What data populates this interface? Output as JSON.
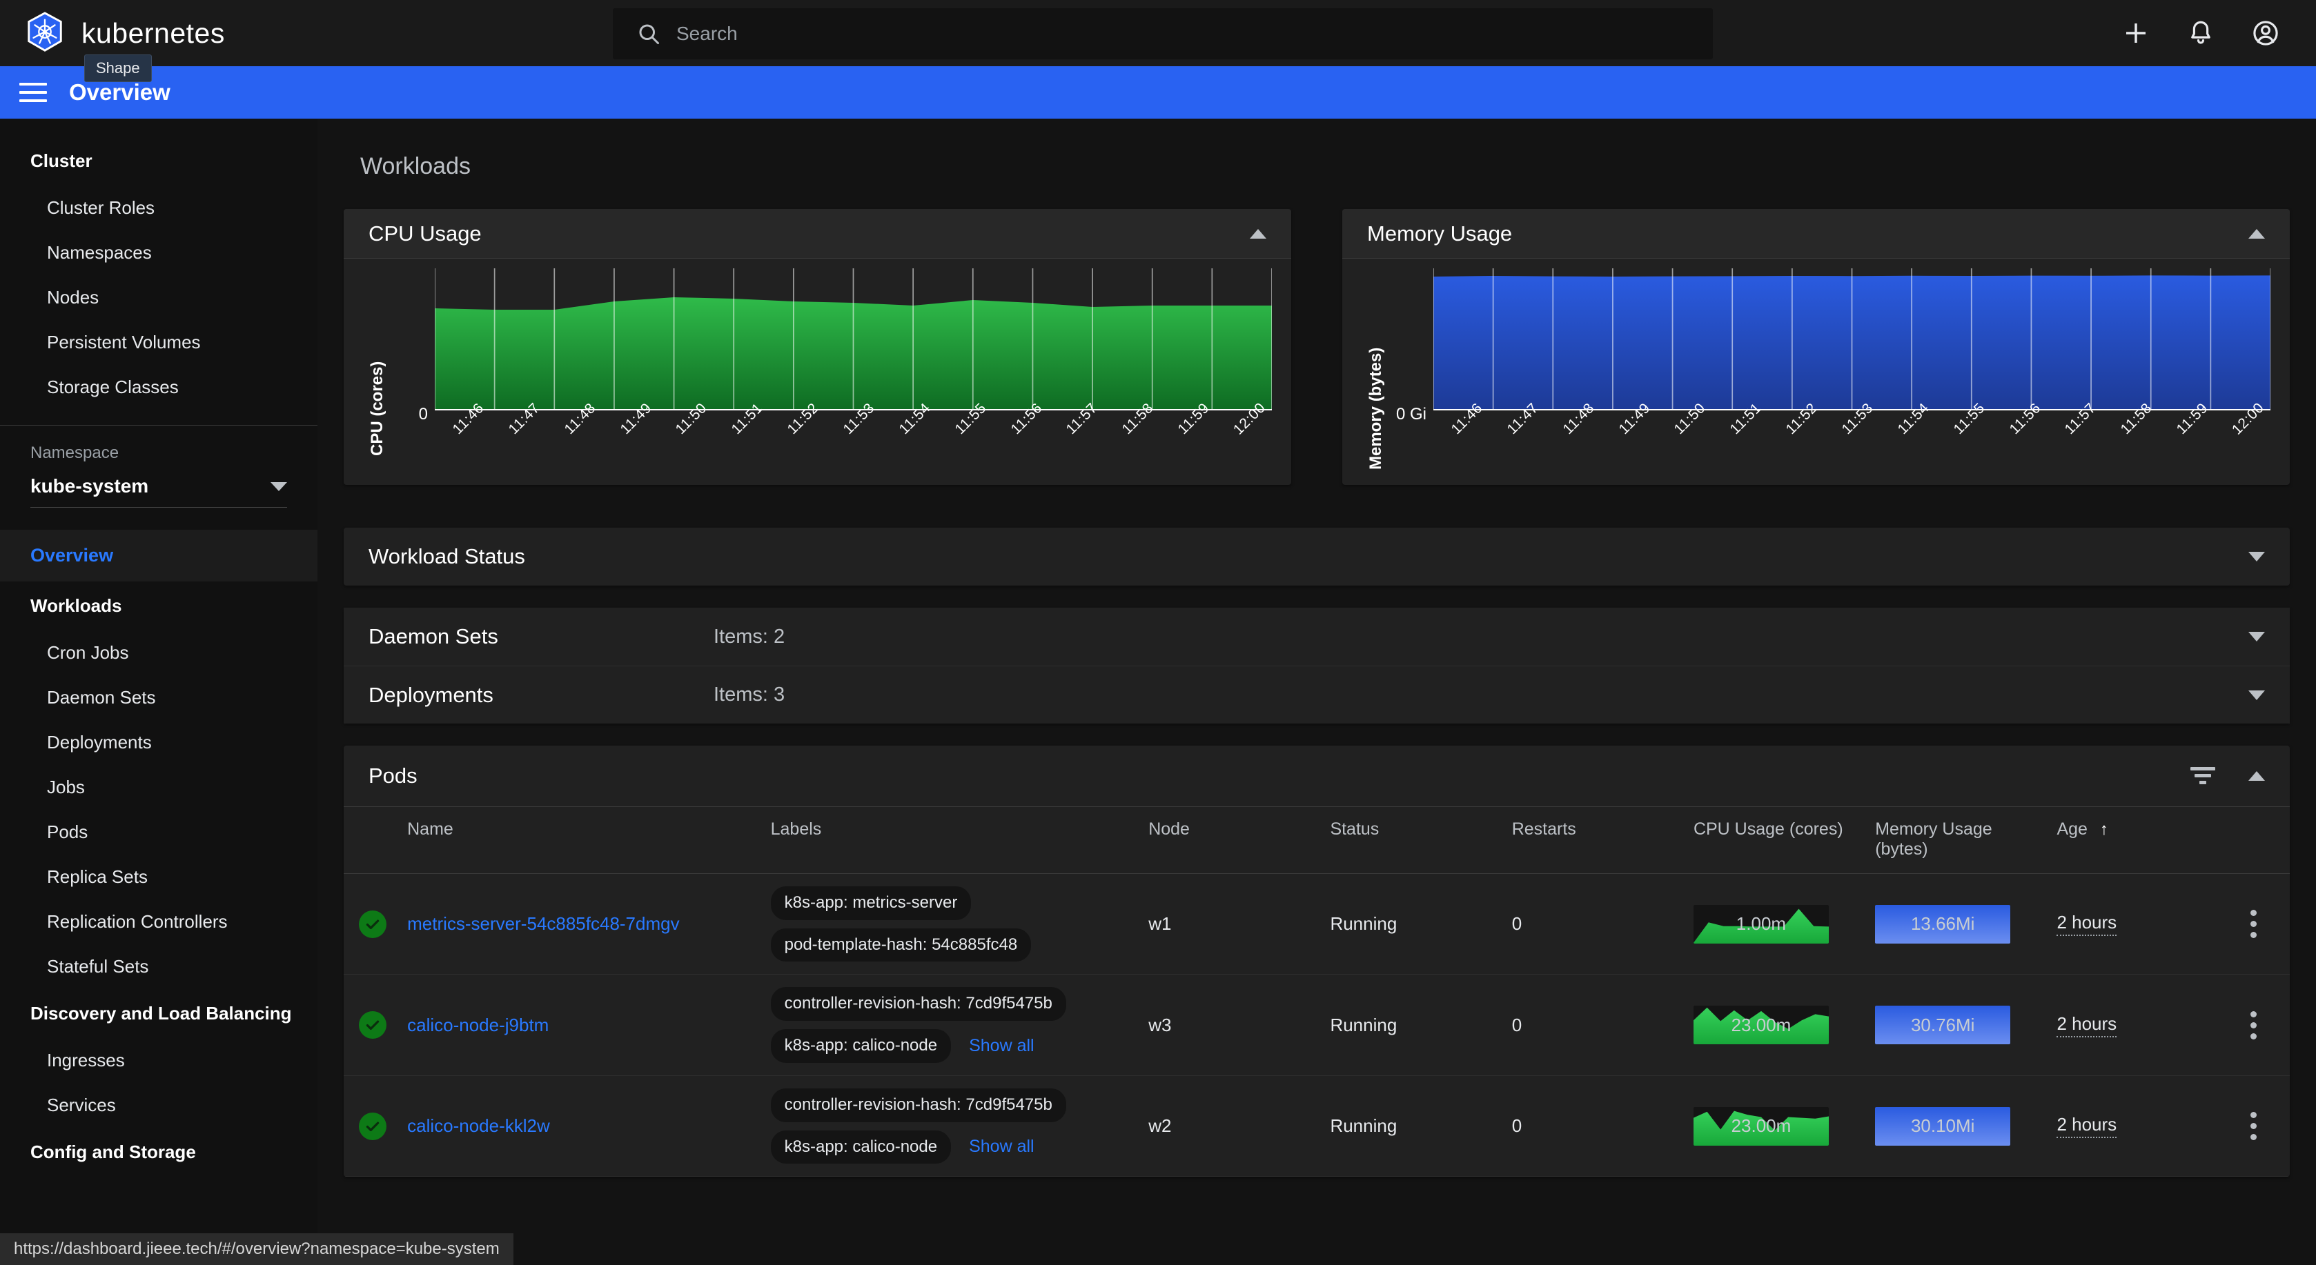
{
  "header": {
    "brand": "kubernetes",
    "logo_tooltip": "Shape",
    "search_placeholder": "Search",
    "search_value": "",
    "icons": {
      "search": "search-icon",
      "add": "plus-icon",
      "notifications": "bell-icon",
      "account": "account-circle-icon"
    }
  },
  "titlebar": {
    "title": "Overview",
    "menu_icon": "hamburger-menu-icon"
  },
  "sidebar": {
    "groups": [
      {
        "title": "Cluster",
        "items": [
          "Cluster Roles",
          "Namespaces",
          "Nodes",
          "Persistent Volumes",
          "Storage Classes"
        ]
      },
      {
        "title": "Workloads",
        "items": [
          "Cron Jobs",
          "Daemon Sets",
          "Deployments",
          "Jobs",
          "Pods",
          "Replica Sets",
          "Replication Controllers",
          "Stateful Sets"
        ]
      },
      {
        "title": "Discovery and Load Balancing",
        "items": [
          "Ingresses",
          "Services"
        ]
      },
      {
        "title": "Config and Storage",
        "items": []
      }
    ],
    "namespace_label": "Namespace",
    "namespace_value": "kube-system",
    "active_item": "Overview"
  },
  "main": {
    "section_heading": "Workloads",
    "accordions": [
      {
        "title": "Workload Status",
        "items": ""
      },
      {
        "title": "Daemon Sets",
        "items": "Items: 2"
      },
      {
        "title": "Deployments",
        "items": "Items: 3"
      }
    ],
    "pods": {
      "title": "Pods",
      "columns": [
        "",
        "Name",
        "Labels",
        "Node",
        "Status",
        "Restarts",
        "CPU Usage (cores)",
        "Memory Usage (bytes)",
        "Age"
      ],
      "sorted_column": "Age",
      "sort_direction": "↑",
      "show_all_label": "Show all",
      "rows": [
        {
          "status_icon": "check-circle-icon",
          "name": "metrics-server-54c885fc48-7dmgv",
          "labels": [
            "k8s-app: metrics-server",
            "pod-template-hash: 54c885fc48"
          ],
          "has_show_all": false,
          "node": "w1",
          "status": "Running",
          "restarts": "0",
          "cpu": "1.00m",
          "memory": "13.66Mi",
          "age": "2 hours"
        },
        {
          "status_icon": "check-circle-icon",
          "name": "calico-node-j9btm",
          "labels": [
            "controller-revision-hash: 7cd9f5475b",
            "k8s-app: calico-node"
          ],
          "has_show_all": true,
          "node": "w3",
          "status": "Running",
          "restarts": "0",
          "cpu": "23.00m",
          "memory": "30.76Mi",
          "age": "2 hours"
        },
        {
          "status_icon": "check-circle-icon",
          "name": "calico-node-kkl2w",
          "labels": [
            "controller-revision-hash: 7cd9f5475b",
            "k8s-app: calico-node"
          ],
          "has_show_all": true,
          "node": "w2",
          "status": "Running",
          "restarts": "0",
          "cpu": "23.00m",
          "memory": "30.10Mi",
          "age": "2 hours"
        }
      ]
    }
  },
  "statusbar": {
    "url": "https://dashboard.jieee.tech/#/overview?namespace=kube-system"
  },
  "colors": {
    "accent_blue": "#2962f2",
    "link_blue": "#2979ff",
    "cpu_green": "#21a038",
    "memory_blue": "#2a5be0",
    "status_ok_green": "#0d7a16",
    "surface": "#212121",
    "background": "#131313"
  },
  "chart_data": [
    {
      "type": "area",
      "title": "CPU Usage",
      "xlabel": "",
      "ylabel": "CPU (cores)",
      "categories": [
        "11:46",
        "11:47",
        "11:48",
        "11:49",
        "11:50",
        "11:51",
        "11:52",
        "11:53",
        "11:54",
        "11:55",
        "11:56",
        "11:57",
        "11:58",
        "11:59",
        "12:00"
      ],
      "values": [
        0.74,
        0.73,
        0.73,
        0.79,
        0.82,
        0.81,
        0.79,
        0.78,
        0.76,
        0.8,
        0.78,
        0.75,
        0.76,
        0.76,
        0.76
      ],
      "ylim": [
        0,
        1.0
      ],
      "ytick_labels": [
        "0"
      ],
      "grid": true,
      "legend": "none",
      "color": "#21a038"
    },
    {
      "type": "area",
      "title": "Memory Usage",
      "xlabel": "",
      "ylabel": "Memory (bytes)",
      "categories": [
        "11:46",
        "11:47",
        "11:48",
        "11:49",
        "11:50",
        "11:51",
        "11:52",
        "11:53",
        "11:54",
        "11:55",
        "11:56",
        "11:57",
        "11:58",
        "11:59",
        "12:00"
      ],
      "values": [
        0.97,
        0.975,
        0.972,
        0.97,
        0.972,
        0.973,
        0.975,
        0.974,
        0.976,
        0.975,
        0.977,
        0.976,
        0.978,
        0.977,
        0.978
      ],
      "ylim": [
        0,
        1.0
      ],
      "ytick_labels": [
        "0 Gi"
      ],
      "grid": true,
      "legend": "none",
      "color": "#2a5be0"
    }
  ],
  "sparklines": {
    "cpu": [
      [
        0.02,
        0.55,
        0.45,
        0.45,
        0.44,
        0.44,
        0.44,
        0.9,
        0.45,
        0.44
      ],
      [
        0.62,
        0.95,
        0.6,
        0.88,
        0.62,
        0.86,
        0.58,
        0.4,
        0.62,
        0.78,
        0.72
      ],
      [
        0.72,
        0.88,
        0.42,
        0.9,
        0.8,
        0.74,
        0.4,
        0.74,
        0.72,
        0.7,
        0.76
      ]
    ]
  }
}
